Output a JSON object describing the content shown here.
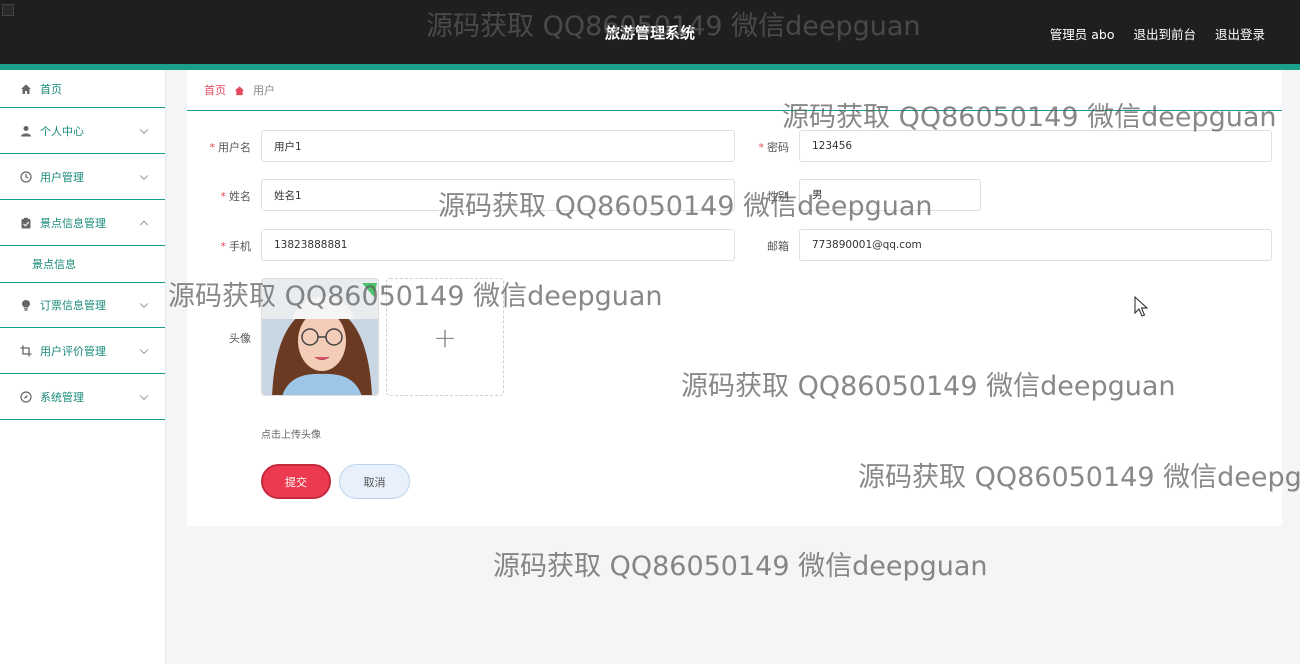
{
  "header": {
    "title": "旅游管理系统",
    "links": [
      "管理员 abo",
      "退出到前台",
      "退出登录"
    ]
  },
  "sidebar": {
    "items": [
      {
        "label": "首页",
        "icon": "home-icon"
      },
      {
        "label": "个人中心",
        "icon": "user-icon"
      },
      {
        "label": "用户管理",
        "icon": "clock-icon"
      },
      {
        "label": "景点信息管理",
        "icon": "clipboard-icon",
        "expanded": true,
        "children": [
          "景点信息"
        ]
      },
      {
        "label": "订票信息管理",
        "icon": "bulb-icon"
      },
      {
        "label": "用户评价管理",
        "icon": "crop-icon"
      },
      {
        "label": "系统管理",
        "icon": "compass-icon"
      }
    ]
  },
  "breadcrumb": {
    "home": "首页",
    "current": "用户"
  },
  "form": {
    "username": {
      "label": "用户名",
      "value": "用户1"
    },
    "password": {
      "label": "密码",
      "value": "123456"
    },
    "name": {
      "label": "姓名",
      "value": "姓名1"
    },
    "gender": {
      "label": "性别",
      "value": "男"
    },
    "phone": {
      "label": "手机",
      "value": "13823888881"
    },
    "email": {
      "label": "邮箱",
      "value": "773890001@qq.com"
    },
    "avatar": {
      "label": "头像",
      "upload_plus": "+",
      "hint": "点击上传头像"
    },
    "submit_label": "提交",
    "cancel_label": "取消"
  },
  "watermark": "源码获取 QQ86050149 微信deepguan",
  "colors": {
    "accent": "#1aa08a",
    "danger": "#ec3b50",
    "header_bg": "#1f1f1f"
  }
}
